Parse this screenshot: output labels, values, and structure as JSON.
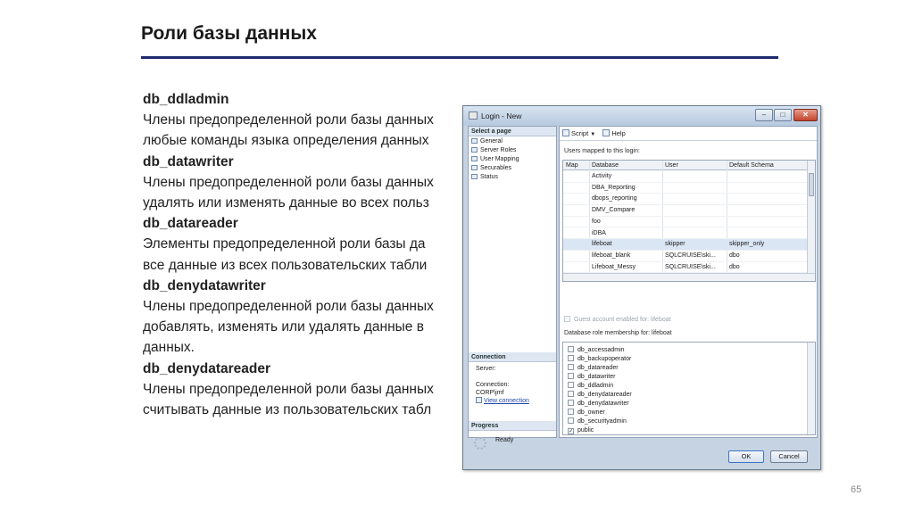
{
  "slide": {
    "title": "Роли базы данных",
    "page_number": "65",
    "lines": [
      {
        "text": "db_ddladmin",
        "bold": true
      },
      {
        "text": "Члены предопределенной роли базы данных",
        "bold": false
      },
      {
        "text": "любые команды языка определения данных",
        "bold": false
      },
      {
        "text": "db_datawriter",
        "bold": true
      },
      {
        "text": "Члены предопределенной роли базы данных",
        "bold": false
      },
      {
        "text": "удалять или изменять данные во всех польз",
        "bold": false
      },
      {
        "text": "db_datareader",
        "bold": true
      },
      {
        "text": "Элементы предопределенной роли базы да",
        "bold": false
      },
      {
        "text": "все данные из всех пользовательских табли",
        "bold": false
      },
      {
        "text": "db_denydatawriter",
        "bold": true
      },
      {
        "text": "Члены предопределенной роли базы данных",
        "bold": false
      },
      {
        "text": "добавлять, изменять или удалять данные в",
        "bold": false
      },
      {
        "text": "данных.",
        "bold": false
      },
      {
        "text": "db_denydatareader",
        "bold": true
      },
      {
        "text": "Члены предопределенной роли базы данных",
        "bold": false
      },
      {
        "text": "считывать данные из пользовательских табл",
        "bold": false
      }
    ]
  },
  "dialog": {
    "title": "Login - New",
    "select_page_label": "Select a page",
    "pages": [
      "General",
      "Server Roles",
      "User Mapping",
      "Securables",
      "Status"
    ],
    "toolbar": {
      "script": "Script",
      "help": "Help"
    },
    "users_mapped_label": "Users mapped to this login:",
    "columns": {
      "map": "Map",
      "database": "Database",
      "user": "User",
      "schema": "Default Schema"
    },
    "rows": [
      {
        "checked": false,
        "database": "Activity",
        "user": "",
        "schema": ""
      },
      {
        "checked": false,
        "database": "DBA_Reporting",
        "user": "",
        "schema": ""
      },
      {
        "checked": false,
        "database": "dbops_reporting",
        "user": "",
        "schema": ""
      },
      {
        "checked": false,
        "database": "DMV_Compare",
        "user": "",
        "schema": ""
      },
      {
        "checked": false,
        "database": "foo",
        "user": "",
        "schema": ""
      },
      {
        "checked": false,
        "database": "iDBA",
        "user": "",
        "schema": ""
      },
      {
        "checked": true,
        "database": "lifeboat",
        "user": "skipper",
        "schema": "skipper_only",
        "selected": true
      },
      {
        "checked": true,
        "database": "lifeboat_blank",
        "user": "SQLCRUISE\\ski...",
        "schema": "dbo"
      },
      {
        "checked": true,
        "database": "Lifeboat_Messy",
        "user": "SQLCRUISE\\ski...",
        "schema": "dbo"
      }
    ],
    "guest_label": "Guest account enabled for: lifeboat",
    "role_membership_label": "Database role membership for: lifeboat",
    "roles": [
      {
        "name": "db_accessadmin",
        "checked": false
      },
      {
        "name": "db_backupoperator",
        "checked": false
      },
      {
        "name": "db_datareader",
        "checked": false
      },
      {
        "name": "db_datawriter",
        "checked": false
      },
      {
        "name": "db_ddladmin",
        "checked": false
      },
      {
        "name": "db_denydatareader",
        "checked": false
      },
      {
        "name": "db_denydatawriter",
        "checked": false
      },
      {
        "name": "db_owner",
        "checked": false
      },
      {
        "name": "db_securityadmin",
        "checked": false
      },
      {
        "name": "public",
        "checked": true
      }
    ],
    "connection": {
      "heading": "Connection",
      "server_label": "Server:",
      "connection_label": "Connection:",
      "connection_value": "CORP\\jmf",
      "view_link": "View connection"
    },
    "progress": {
      "heading": "Progress",
      "status": "Ready"
    },
    "buttons": {
      "ok": "OK",
      "cancel": "Cancel"
    },
    "window_controls": {
      "minimize": "–",
      "maximize": "□",
      "close": "✕"
    },
    "scroll_glyphs": {
      "up": "▲",
      "down": "▼",
      "left": "◀",
      "right": "▶"
    },
    "check_glyph": "✓",
    "dropdown_glyph": "▼"
  }
}
